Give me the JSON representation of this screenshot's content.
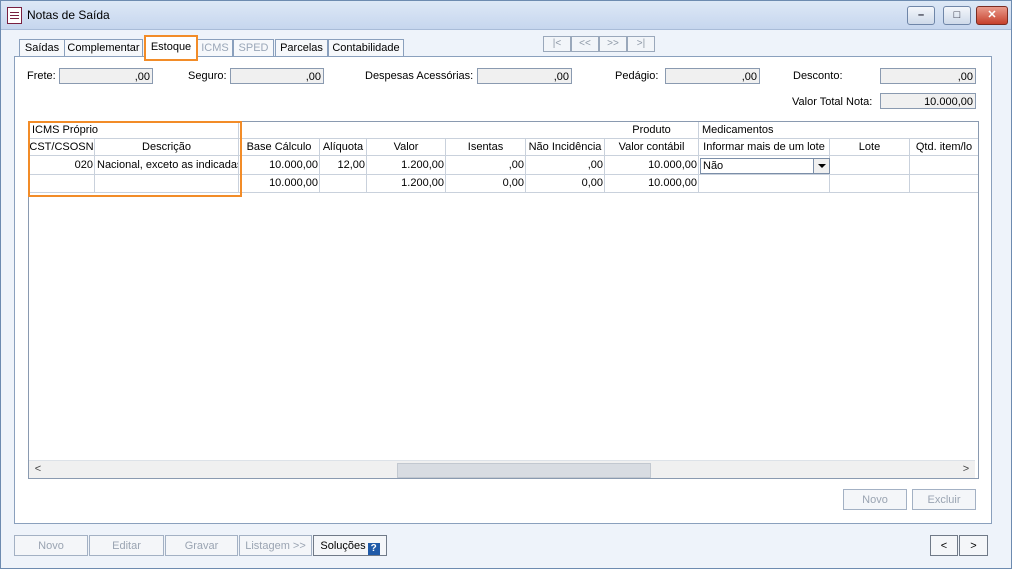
{
  "window": {
    "title": "Notas de Saída"
  },
  "tabs": [
    {
      "label": "Saídas"
    },
    {
      "label": "Complementar"
    },
    {
      "label": "Estoque"
    },
    {
      "label": "ICMS"
    },
    {
      "label": "SPED"
    },
    {
      "label": "Parcelas"
    },
    {
      "label": "Contabilidade"
    }
  ],
  "record_nav": {
    "first": "|<",
    "prev": "<<",
    "next": ">>",
    "last": ">|"
  },
  "fields": {
    "frete": {
      "label": "Frete:",
      "value": ",00"
    },
    "seguro": {
      "label": "Seguro:",
      "value": ",00"
    },
    "despesas": {
      "label": "Despesas Acessórias:",
      "value": ",00"
    },
    "pedagio": {
      "label": "Pedágio:",
      "value": ",00"
    },
    "desconto": {
      "label": "Desconto:",
      "value": ",00"
    },
    "valor_total": {
      "label": "Valor Total Nota:",
      "value": "10.000,00"
    }
  },
  "grid": {
    "groups": {
      "icms": "ICMS Próprio",
      "produto": "Produto",
      "medicamentos": "Medicamentos"
    },
    "columns": [
      "CST/CSOSN",
      "Descrição",
      "Base Cálculo",
      "Alíquota",
      "Valor",
      "Isentas",
      "Não Incidência",
      "Valor contábil",
      "Informar mais de um lote",
      "Lote",
      "Qtd. item/lo"
    ],
    "row1": [
      "020",
      "Nacional, exceto as indicadas",
      "10.000,00",
      "12,00",
      "1.200,00",
      ",00",
      ",00",
      "10.000,00",
      "Não",
      "",
      ""
    ],
    "totals": [
      "",
      "",
      "10.000,00",
      "",
      "1.200,00",
      "0,00",
      "0,00",
      "10.000,00",
      "",
      "",
      ""
    ]
  },
  "actions": {
    "grid_novo": "Novo",
    "grid_excluir": "Excluir",
    "novo": "Novo",
    "editar": "Editar",
    "gravar": "Gravar",
    "listagem": "Listagem >>",
    "solucoes": "Soluções",
    "prev": "<",
    "next": ">"
  }
}
